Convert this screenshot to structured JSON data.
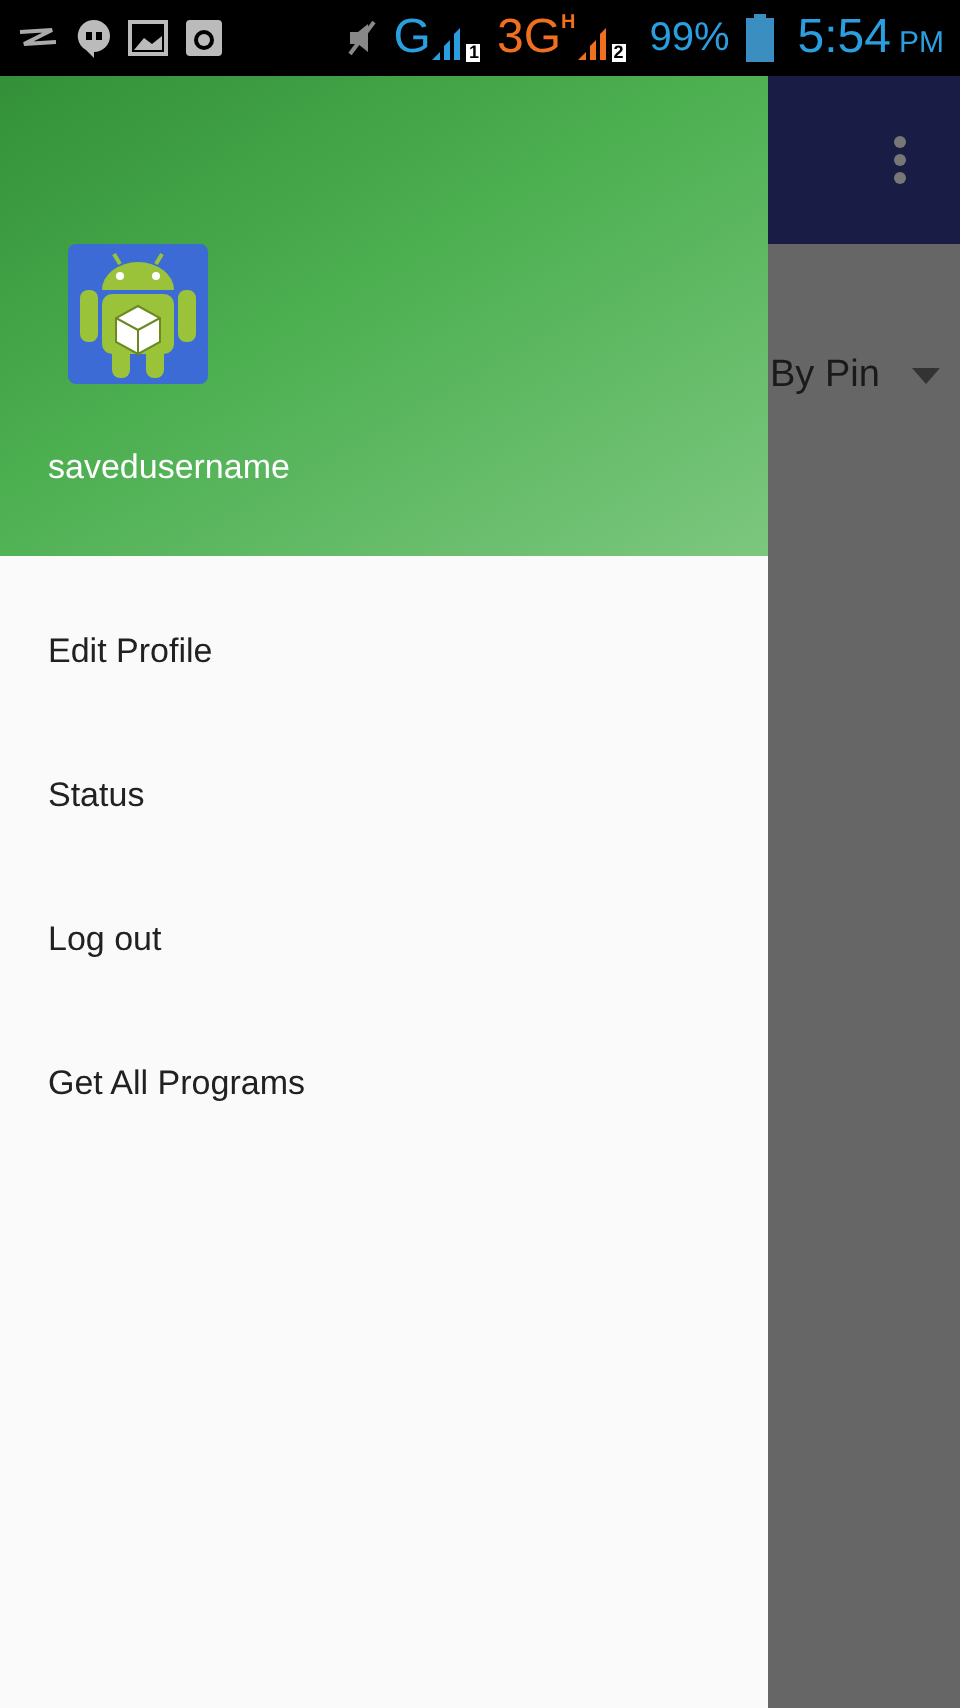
{
  "status_bar": {
    "network_1": "G",
    "sim_1": "1",
    "network_2": "3G",
    "network_2_type": "H",
    "sim_2": "2",
    "battery": "99%",
    "time": "5:54",
    "meridiem": "PM"
  },
  "drawer": {
    "username": "savedusername",
    "items": [
      {
        "label": "Edit Profile"
      },
      {
        "label": "Status"
      },
      {
        "label": "Log out"
      },
      {
        "label": "Get All Programs"
      }
    ]
  },
  "background": {
    "spinner_value": "By Pin"
  }
}
